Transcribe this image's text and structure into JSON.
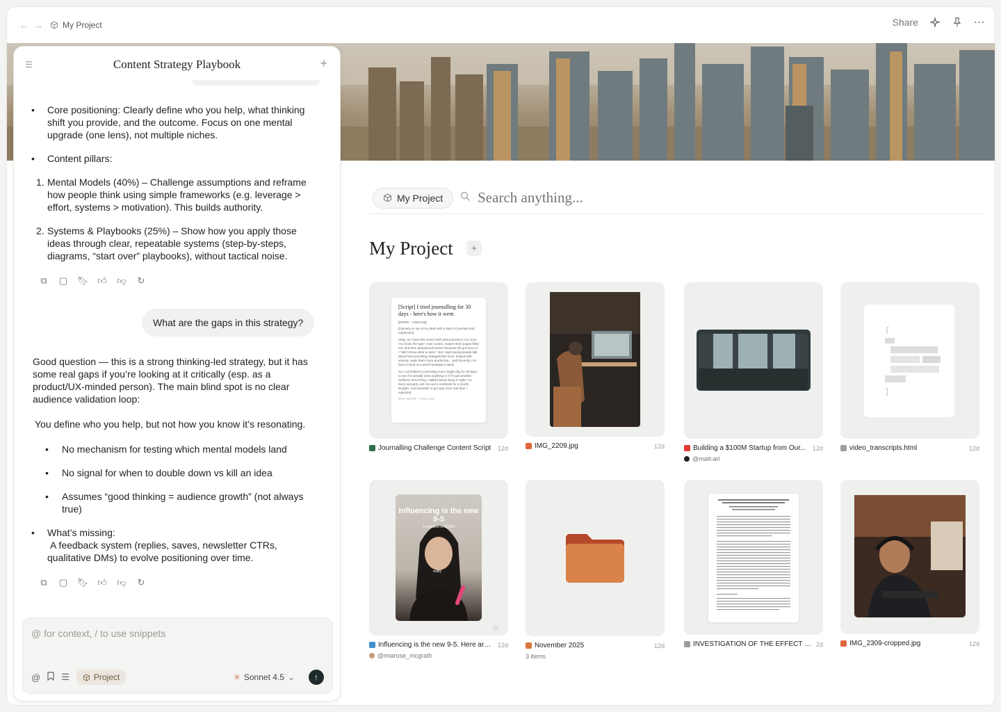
{
  "topbar": {
    "project_name": "My Project",
    "share_label": "Share"
  },
  "chat": {
    "title": "Content Strategy Playbook",
    "assistant_1": [
      "Core positioning: Clearly define who you help, what thinking shift you provide, and the outcome. Focus on one mental upgrade (one lens), not multiple niches.",
      "Content pillars:"
    ],
    "numbered": [
      {
        "n": "1.",
        "text": "Mental Models (40%) – Challenge assumptions and reframe how people think using simple frameworks (e.g. leverage > effort, systems > motivation). This builds authority."
      },
      {
        "n": "2.",
        "text": "Systems & Playbooks (25%) – Show how you apply those ideas through clear, repeatable systems (step-by-steps, diagrams, “start over” playbooks), without tactical noise."
      }
    ],
    "user_message": "What are the gaps in this strategy?",
    "assistant_2_intro": "Good question — this is a strong thinking-led strategy, but it has some real gaps if you’re looking at it critically (esp. as a product/UX-minded person). The main blind spot is no clear audience validation loop:",
    "assistant_2_line": "You define who you help, but not how you know it’s resonating.",
    "gaps": [
      "No mechanism for testing which mental models land",
      "No signal for when to double down vs kill an idea",
      "Assumes “good thinking = audience growth” (not always true)"
    ],
    "missing_label": "What’s missing:",
    "missing_text": "A feedback system (replies, saves, newsletter CTRs, qualitative DMs) to evolve positioning over time.",
    "composer_placeholder": "@ for context, / to use snippets",
    "project_chip": "Project",
    "model": "Sonnet 4.5"
  },
  "main": {
    "search_chip": "My Project",
    "search_placeholder": "Search anything...",
    "title": "My Project",
    "doc_preview": {
      "title": "[Script] I tried journalling for 30 days - here's how it went",
      "intro": "[INTRO – 0:00-0:45]",
      "p1": "[Camera on me at my desk with a stack of journals and notebooks]",
      "p2": "Okay, so I have like seven half-used journals in my room. You know the type—cute covers, maybe three pages filled out, and then abandoned forever because life got busy or I \"didn't know what to write.\" But I kept seeing people talk about how journaling changed their lives, helped with anxiety, made them more productive... and honestly, I've been in kind of a weird headspace lately.",
      "p3": "So I committed to journaling every single day for 30 days to see if it actually does anything or if it's just another wellness trend thing. I talked about doing it \"right,\" no fancy spreads, just me and a notebook for a month straight. And honestly? It got way more real than I expected.",
      "p4": "[DAY SETUP – 0:45-1:30]"
    },
    "influencer_overlay": {
      "title": "Influencing is the new 9-5",
      "subtitle": "4 mistakes to AVOID",
      "caption": "really"
    },
    "files": [
      {
        "name": "Journalling Challenge Content Script",
        "age": "12d",
        "color": "#2f6f4f"
      },
      {
        "name": "IMG_2209.jpg",
        "age": "12d",
        "color": "#e0663a"
      },
      {
        "name": "Building a $100M Startup from Our...",
        "age": "12d",
        "color": "#e53935",
        "sub": "@matt-ari"
      },
      {
        "name": "video_transcripts.html",
        "age": "12d",
        "color": "#9e9e9e"
      },
      {
        "name": "Influencing is the new 9-5. Here are...",
        "age": "12d",
        "color": "#3f8fd0",
        "sub": "@miarose_mcgrath"
      },
      {
        "name": "November 2025",
        "age": "12d",
        "color": "#d9773f",
        "sub": "3 items"
      },
      {
        "name": "INVESTIGATION OF THE EFFECT OF T...",
        "age": "2d",
        "color": "#9e9e9e"
      },
      {
        "name": "IMG_2309-cropped.jpg",
        "age": "12d",
        "color": "#e0663a"
      }
    ]
  }
}
